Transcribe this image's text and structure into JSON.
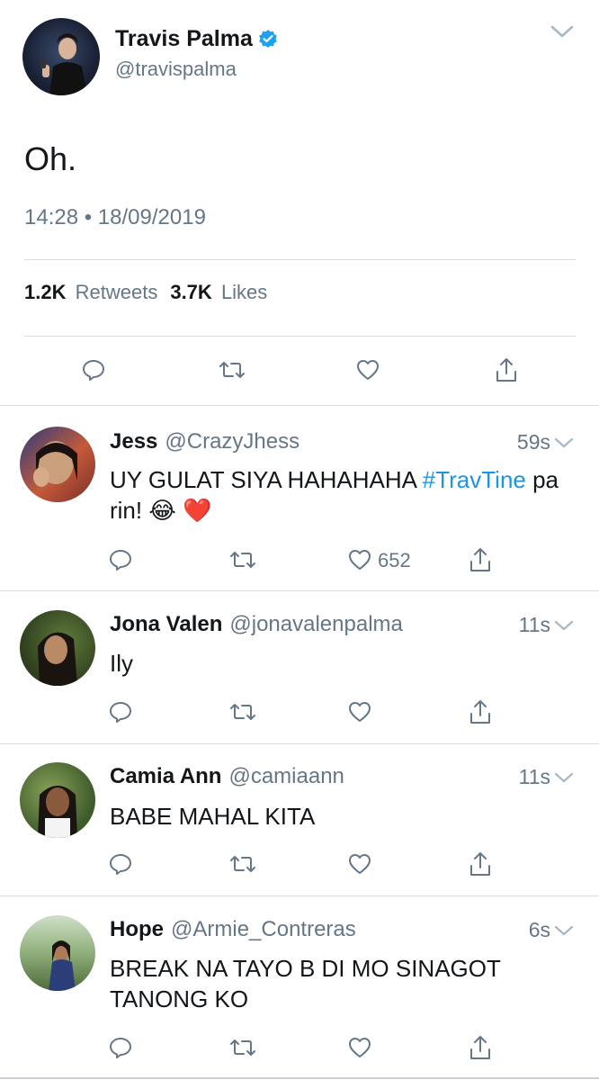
{
  "tweet": {
    "author_name": "Travis Palma",
    "author_handle": "@travispalma",
    "text": "Oh.",
    "timestamp": "14:28 • 18/09/2019",
    "retweets_count": "1.2K",
    "retweets_label": "Retweets",
    "likes_count": "3.7K",
    "likes_label": "Likes"
  },
  "replies": [
    {
      "name": "Jess",
      "handle": "@CrazyJhess",
      "time": "59s",
      "text_before": "UY GULAT SIYA HAHAHAHA ",
      "hashtag": "#TravTine",
      "text_after": " pa rin! 😂 ❤️",
      "likes": "652"
    },
    {
      "name": "Jona Valen",
      "handle": "@jonavalenpalma",
      "time": "11s",
      "text": "Ily"
    },
    {
      "name": "Camia Ann",
      "handle": "@camiaann",
      "time": "11s",
      "text": "BABE MAHAL KITA"
    },
    {
      "name": "Hope",
      "handle": "@Armie_Contreras",
      "time": "6s",
      "text": "BREAK NA TAYO B DI MO SINAGOT TANONG KO"
    }
  ],
  "colors": {
    "verified": "#1da1f2",
    "hashtag": "#1b95e0",
    "secondary_text": "#657786",
    "heart": "#e0245e"
  },
  "icons": [
    "verified-badge-icon",
    "chevron-down-icon",
    "reply-icon",
    "retweet-icon",
    "like-icon",
    "share-icon"
  ]
}
